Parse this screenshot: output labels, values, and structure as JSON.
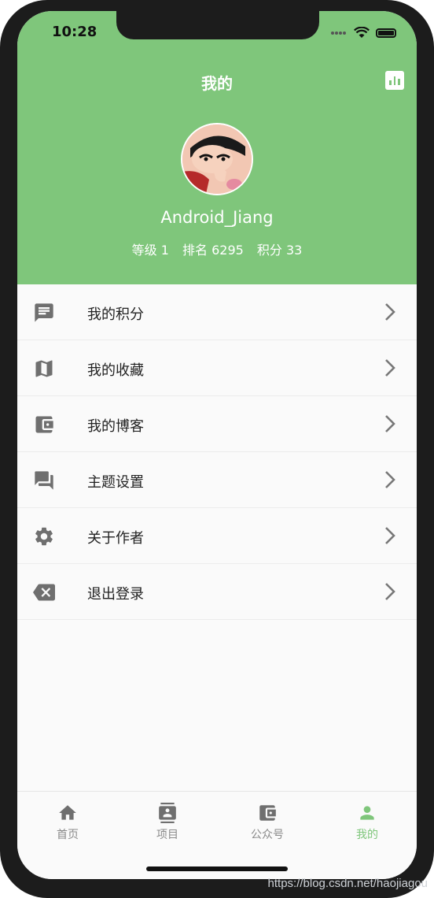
{
  "status_bar": {
    "time": "10:28"
  },
  "header": {
    "title": "我的",
    "username": "Android_Jiang",
    "stats": [
      "等级 1",
      "排名 6295",
      "积分 33"
    ],
    "chart_icon": "bar-chart-icon",
    "accent": "#7fc67b"
  },
  "menu": {
    "items": [
      {
        "label": "我的积分",
        "icon": "message-icon"
      },
      {
        "label": "我的收藏",
        "icon": "map-icon"
      },
      {
        "label": "我的博客",
        "icon": "wallet-icon"
      },
      {
        "label": "主题设置",
        "icon": "forum-icon"
      },
      {
        "label": "关于作者",
        "icon": "settings-icon"
      },
      {
        "label": "退出登录",
        "icon": "backspace-icon"
      }
    ]
  },
  "tabs": [
    {
      "label": "首页",
      "icon": "home-icon"
    },
    {
      "label": "项目",
      "icon": "contacts-icon"
    },
    {
      "label": "公众号",
      "icon": "wallet-icon"
    },
    {
      "label": "我的",
      "icon": "person-icon",
      "active": true
    }
  ],
  "watermark": "https://blog.csdn.net/haojiagou"
}
